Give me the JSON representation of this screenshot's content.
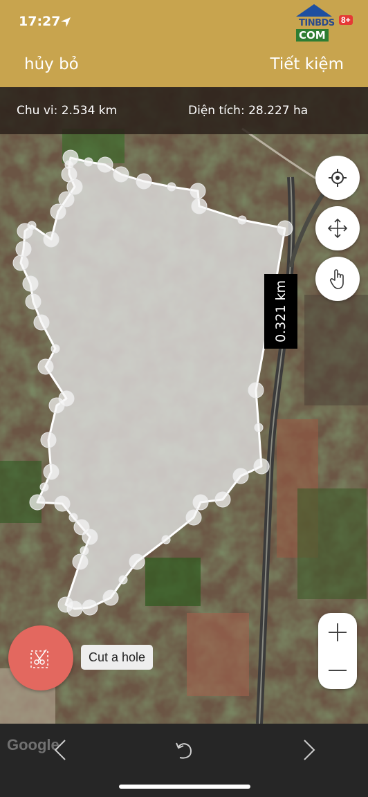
{
  "status": {
    "time": "17:27"
  },
  "logo": {
    "line1": "TINBDS",
    "line2": "COM",
    "badge": "8+"
  },
  "header": {
    "cancel_label": "hủy bỏ",
    "save_label": "Tiết kiệm"
  },
  "info": {
    "perimeter": "Chu vi: 2.534 km",
    "area": "Diện tích: 28.227 ha"
  },
  "map": {
    "distance_label": "0.321 km",
    "attribution": "Google"
  },
  "tools": {
    "cut_hole_label": "Cut a hole"
  },
  "icons": {
    "locate": "crosshair-icon",
    "move": "move-arrows-icon",
    "touch": "hand-pointer-icon",
    "zoom_in": "plus-icon",
    "zoom_out": "minus-icon",
    "cut": "scissors-icon",
    "back": "chevron-left-icon",
    "undo": "undo-icon",
    "forward": "chevron-right-icon"
  },
  "colors": {
    "header": "#c8a44e",
    "fab": "#e3685f",
    "bottom_bar": "#262626"
  }
}
